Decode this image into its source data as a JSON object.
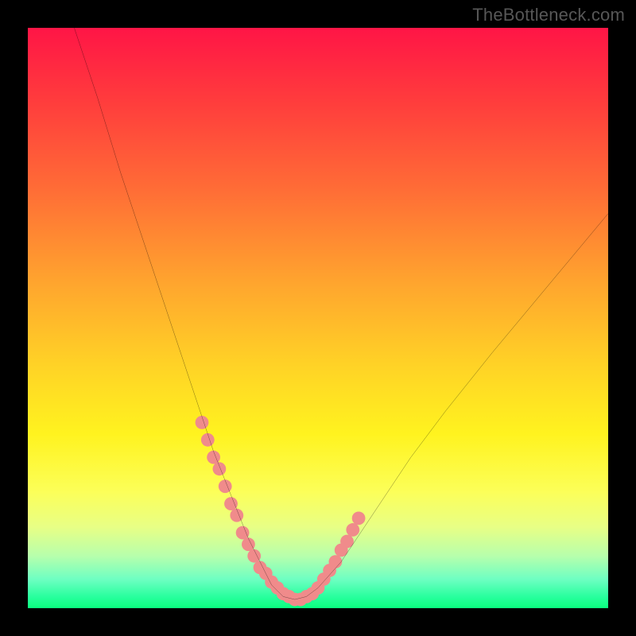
{
  "watermark": "TheBottleneck.com",
  "chart_data": {
    "type": "line",
    "title": "",
    "xlabel": "",
    "ylabel": "",
    "xlim": [
      0,
      100
    ],
    "ylim": [
      0,
      100
    ],
    "curve": {
      "name": "bottleneck-curve",
      "x": [
        8,
        12,
        16,
        20,
        24,
        28,
        30,
        32,
        34,
        36,
        38,
        40,
        41,
        42,
        43,
        44,
        46,
        48,
        50,
        54,
        58,
        62,
        66,
        72,
        80,
        90,
        100
      ],
      "y": [
        100,
        88,
        75,
        63,
        51,
        39,
        33,
        27,
        22,
        17,
        12,
        8,
        6,
        4,
        3,
        2,
        1.5,
        2,
        3.5,
        8,
        14,
        20,
        26,
        34,
        44,
        56,
        68
      ]
    },
    "marker_cluster": {
      "name": "highlighted-points",
      "color": "#f08b8b",
      "x": [
        30,
        31,
        32,
        33,
        34,
        35,
        36,
        37,
        38,
        39,
        40,
        41,
        42,
        43,
        44,
        45,
        46,
        47,
        48,
        49,
        50,
        51,
        52,
        53,
        54,
        55,
        56,
        57
      ],
      "y": [
        32,
        29,
        26,
        24,
        21,
        18,
        16,
        13,
        11,
        9,
        7,
        6,
        4.5,
        3.5,
        2.5,
        2,
        1.5,
        1.5,
        2,
        2.5,
        3.5,
        5,
        6.5,
        8,
        10,
        11.5,
        13.5,
        15.5
      ]
    }
  }
}
